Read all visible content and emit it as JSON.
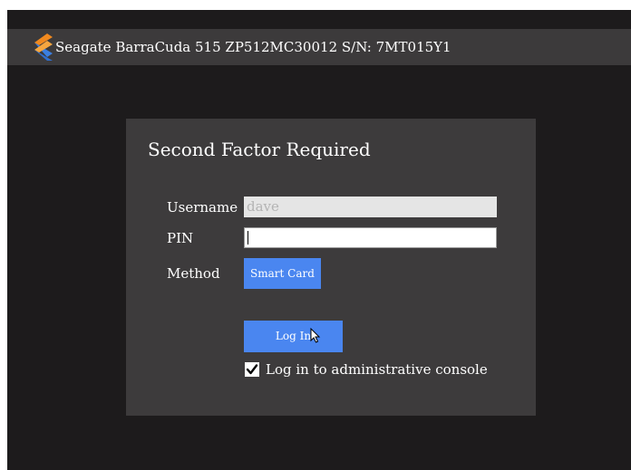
{
  "header": {
    "device_title": "Seagate BarraCuda 515 ZP512MC30012 S/N: 7MT015Y1",
    "logo_icon": "chevron-stack-logo-icon"
  },
  "dialog": {
    "title": "Second Factor Required",
    "username_label": "Username",
    "username_value": "dave",
    "pin_label": "PIN",
    "pin_value": "",
    "method_label": "Method",
    "method_value": "Smart Card",
    "login_label": "Log In",
    "admin_console_label": "Log in to administrative console",
    "admin_console_checked": true
  },
  "colors": {
    "background": "#1d1b1c",
    "topbar": "#3c3a3b",
    "panel": "#3d3b3c",
    "accent_button": "#4a86f0",
    "logo_orange": "#f0891f",
    "logo_blue": "#3b7fe0"
  }
}
